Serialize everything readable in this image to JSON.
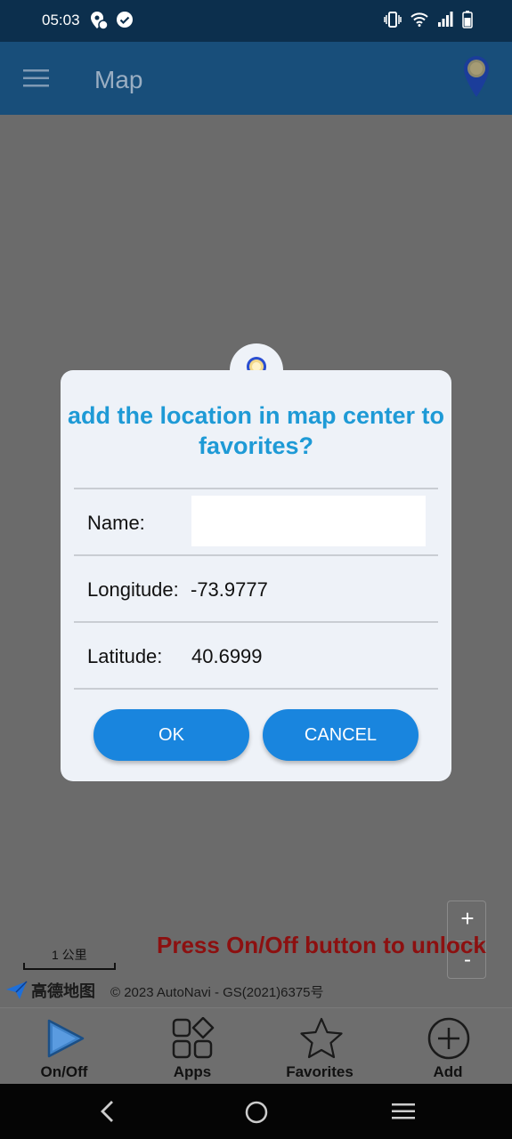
{
  "status_bar": {
    "time": "05:03",
    "icons_left": [
      "location-icon",
      "check-circle-icon"
    ],
    "icons_right": [
      "vibrate-icon",
      "wifi-icon",
      "signal-icon",
      "battery-icon"
    ]
  },
  "app_bar": {
    "title": "Map"
  },
  "dialog": {
    "title": "add the location in map center to favorites?",
    "name_label": "Name:",
    "name_value": "",
    "longitude_label": "Longitude:",
    "longitude_value": "-73.9777",
    "latitude_label": "Latitude:",
    "latitude_value": "40.6999",
    "ok_label": "OK",
    "cancel_label": "CANCEL"
  },
  "map": {
    "zoom_in": "+",
    "zoom_out": "-",
    "unlock_message": "Press On/Off button to unlock",
    "scale_label": "1 公里",
    "logo_text": "高德地图",
    "copyright": "© 2023 AutoNavi - GS(2021)6375号"
  },
  "bottom_nav": [
    {
      "label": "On/Off",
      "icon": "play-icon"
    },
    {
      "label": "Apps",
      "icon": "apps-icon"
    },
    {
      "label": "Favorites",
      "icon": "star-icon"
    },
    {
      "label": "Add",
      "icon": "add-circle-icon"
    }
  ],
  "colors": {
    "accent": "#1985de",
    "title": "#1e9ad6",
    "warning_text": "#8c1010",
    "app_bar": "#184e7a"
  }
}
